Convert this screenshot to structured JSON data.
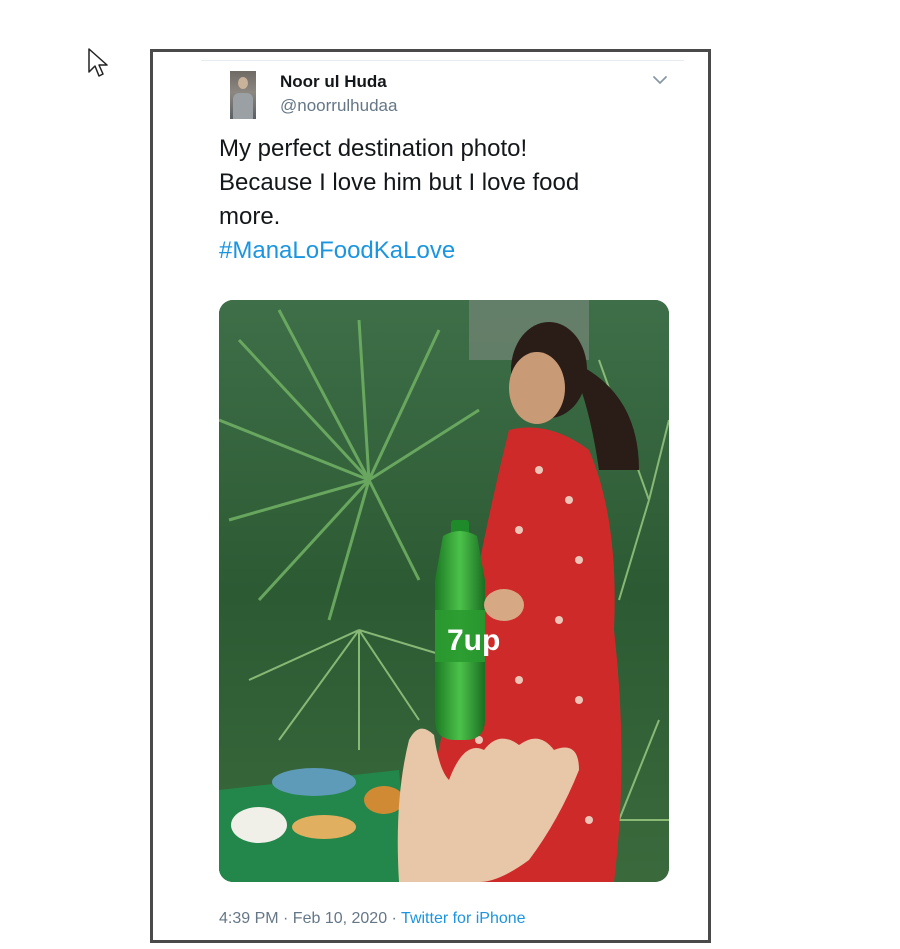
{
  "tweet": {
    "display_name": "Noor ul Huda",
    "handle": "@noorrulhudaa",
    "text_lines": [
      "My perfect destination photo!",
      "Because I love him but I love food",
      "more."
    ],
    "hashtag": "#ManaLoFoodKaLove",
    "timestamp": "4:39 PM · Feb 10, 2020",
    "separator": " · ",
    "source": "Twitter for iPhone"
  },
  "photo": {
    "bottle_logo": "7up"
  },
  "icons": {
    "cursor": "mouse-pointer-icon",
    "caret": "chevron-down-icon"
  },
  "colors": {
    "link": "#1b95e0",
    "secondary_text": "#657786",
    "primary_text": "#14171a",
    "frame_border": "#4a4a4a"
  }
}
